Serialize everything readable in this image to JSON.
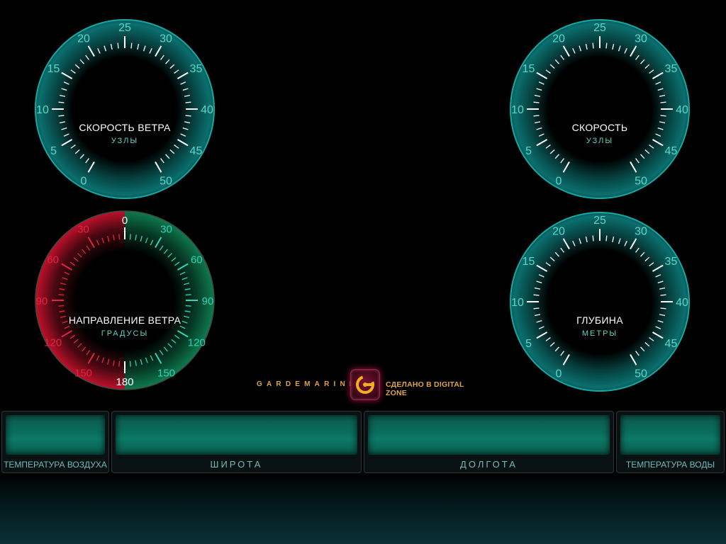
{
  "colors": {
    "dial_teal": "#0a6f6e",
    "dial_rim": "#14a8a4",
    "tick_white": "#ffffff",
    "label_teal": "#5fd6c4",
    "port_red": "#c0102a",
    "starboard_green": "#0e7a4e",
    "brand_gold": "#e0a44a",
    "panel_green": "#0a6e5e"
  },
  "gauges": {
    "wind_speed": {
      "title": "СКОРОСТЬ ВЕТРА",
      "unit": "УЗЛЫ",
      "scale": [
        "0",
        "5",
        "10",
        "15",
        "20",
        "25",
        "30",
        "35",
        "40",
        "45",
        "50"
      ]
    },
    "speed": {
      "title": "СКОРОСТЬ",
      "unit": "УЗЛЫ",
      "scale": [
        "0",
        "5",
        "10",
        "15",
        "20",
        "25",
        "30",
        "35",
        "40",
        "45",
        "50"
      ]
    },
    "wind_direction": {
      "title": "НАПРАВЛЕНИЕ ВЕТРА",
      "unit": "ГРАДУСЫ",
      "top_label": "0",
      "bottom_label": "180",
      "left_scale": [
        "30",
        "60",
        "90",
        "120",
        "150"
      ],
      "right_scale": [
        "30",
        "60",
        "90",
        "120",
        "150"
      ]
    },
    "depth": {
      "title": "ГЛУБИНА",
      "unit": "МЕТРЫ",
      "scale": [
        "0",
        "5",
        "10",
        "15",
        "20",
        "25",
        "30",
        "35",
        "40",
        "45",
        "50"
      ]
    }
  },
  "logo": {
    "brand": "GARDEMARINE",
    "credit": "СДЕЛАНО В DIGITAL ZONE",
    "icon": "g-letter-logo-icon"
  },
  "panels": {
    "air_temp": {
      "label": "ТЕМПЕРАТУРА ВОЗДУХА",
      "value": ""
    },
    "latitude": {
      "label": "ШИРОТА",
      "value": ""
    },
    "longitude": {
      "label": "ДОЛГОТА",
      "value": ""
    },
    "water_temp": {
      "label": "ТЕМПЕРАТУРА ВОДЫ",
      "value": ""
    }
  }
}
